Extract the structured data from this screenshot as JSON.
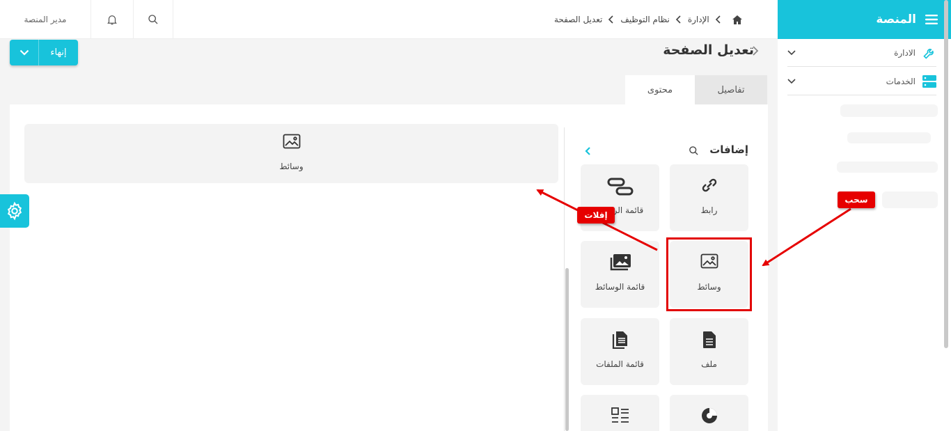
{
  "sidebar": {
    "title": "المنصة",
    "items": [
      {
        "label": "الادارة",
        "icon": "wrench-icon"
      },
      {
        "label": "الخدمات",
        "icon": "server-icon"
      }
    ]
  },
  "topbar": {
    "user_name": "مدير المنصة",
    "breadcrumb": [
      "الإدارة",
      "نظام التوظيف",
      "تعديل الصفحة"
    ]
  },
  "page": {
    "title": "تعديل الصفحة",
    "finish_label": "إنهاء",
    "tabs": {
      "details": "تفاصيل",
      "content": "محتوى"
    }
  },
  "canvas": {
    "dropped_block_label": "وسائط"
  },
  "addons": {
    "title": "إضافات",
    "tiles": [
      {
        "label": "رابط",
        "icon": "link-icon"
      },
      {
        "label": "قائمة الروابط",
        "icon": "link-list-icon"
      },
      {
        "label": "وسائط",
        "icon": "image-icon"
      },
      {
        "label": "قائمة الوسائط",
        "icon": "media-list-icon"
      },
      {
        "label": "ملف",
        "icon": "file-icon"
      },
      {
        "label": "قائمة الملفات",
        "icon": "files-list-icon"
      },
      {
        "label": "",
        "icon": "pie-chart-icon"
      },
      {
        "label": "",
        "icon": "list-grid-icon"
      }
    ]
  },
  "annotations": {
    "drag_label": "سحب",
    "drop_label": "إفلات",
    "color": "#e60000"
  },
  "colors": {
    "accent": "#18c3db"
  }
}
